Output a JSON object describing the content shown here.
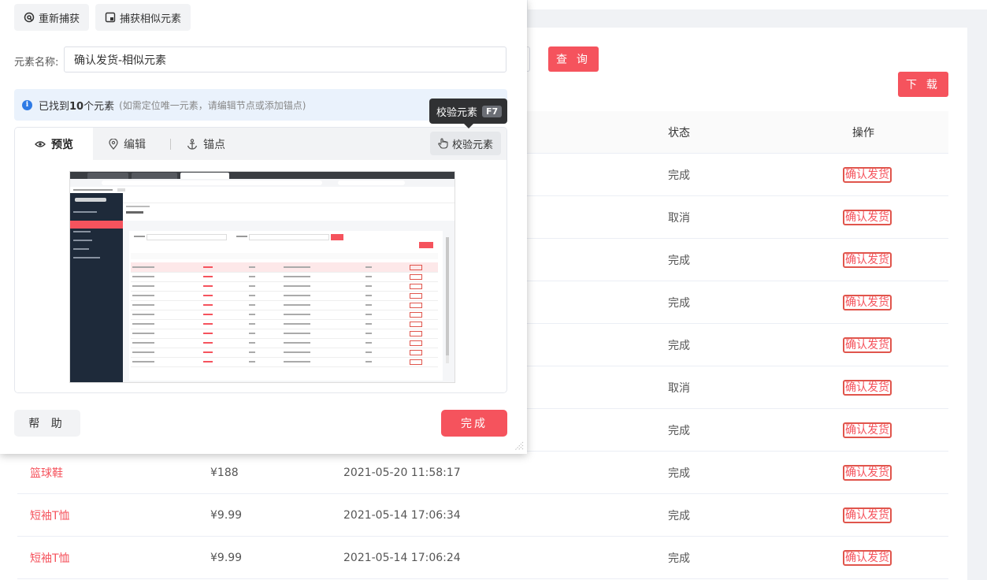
{
  "background": {
    "query_label": "查 询",
    "download_label": "下 载",
    "table": {
      "headers": {
        "status": "状态",
        "operation": "操作"
      },
      "rows": [
        {
          "name": "",
          "price": "",
          "time": "",
          "status": "完成",
          "op": "确认发货"
        },
        {
          "name": "",
          "price": "",
          "time": "",
          "status": "取消",
          "op": "确认发货"
        },
        {
          "name": "",
          "price": "",
          "time": "",
          "status": "完成",
          "op": "确认发货"
        },
        {
          "name": "",
          "price": "",
          "time": "",
          "status": "完成",
          "op": "确认发货"
        },
        {
          "name": "",
          "price": "",
          "time": "",
          "status": "完成",
          "op": "确认发货"
        },
        {
          "name": "",
          "price": "",
          "time": "",
          "status": "取消",
          "op": "确认发货"
        },
        {
          "name": "",
          "price": "",
          "time": "",
          "status": "完成",
          "op": "确认发货"
        },
        {
          "name": "篮球鞋",
          "price": "¥188",
          "time": "2021-05-20 11:58:17",
          "status": "完成",
          "op": "确认发货"
        },
        {
          "name": "短袖T恤",
          "price": "¥9.99",
          "time": "2021-05-14 17:06:34",
          "status": "完成",
          "op": "确认发货"
        },
        {
          "name": "短袖T恤",
          "price": "¥9.99",
          "time": "2021-05-14 17:06:24",
          "status": "完成",
          "op": "确认发货"
        }
      ]
    }
  },
  "dialog": {
    "recapture_label": "重新捕获",
    "capture_similar_label": "捕获相似元素",
    "element_name_label": "元素名称:",
    "element_name_value": "确认发货-相似元素",
    "info": {
      "prefix": "已找到",
      "count": "10",
      "suffix": "个元素",
      "hint": "(如需定位唯一元素，请编辑节点或添加锚点)"
    },
    "tooltip": {
      "label": "校验元素",
      "key": "F7"
    },
    "tabs": {
      "preview": "预览",
      "edit": "编辑",
      "anchor": "锚点",
      "verify": "校验元素"
    },
    "help_label": "帮 助",
    "done_label": "完成"
  },
  "colors": {
    "accent": "#f5535d",
    "info_bg": "#eaf2fc",
    "info_icon": "#2f7be5",
    "tooltip_bg": "#303133"
  },
  "icons": {
    "recapture": "at-icon",
    "capture_similar": "capture-icon",
    "info": "info-icon",
    "preview": "eye-icon",
    "edit": "location-pin-icon",
    "anchor": "anchor-icon",
    "verify": "hand-pointer-icon"
  }
}
